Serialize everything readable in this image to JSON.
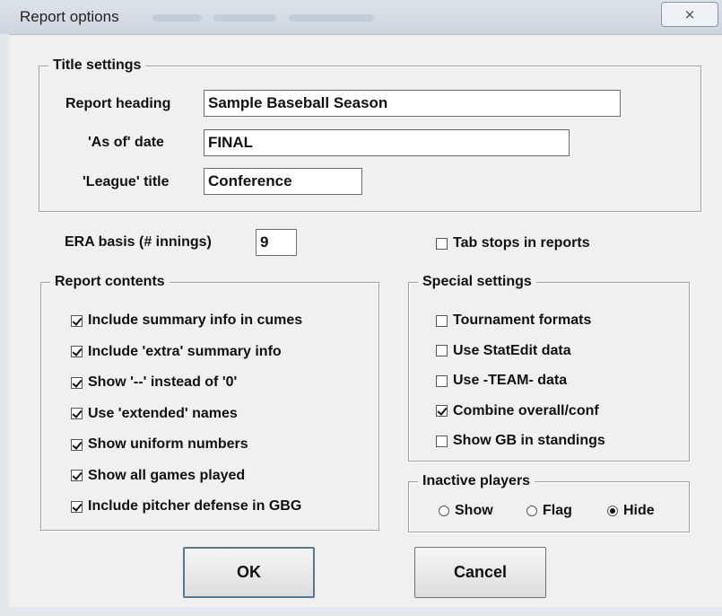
{
  "window": {
    "title": "Report options",
    "close_glyph": "⨯"
  },
  "title_settings": {
    "legend": "Title settings",
    "report_heading": {
      "label": "Report heading",
      "value": "Sample Baseball Season"
    },
    "as_of_date": {
      "label": "'As of' date",
      "value": "FINAL"
    },
    "league_title": {
      "label": "'League' title",
      "value": "Conference"
    }
  },
  "era_basis": {
    "label": "ERA basis (# innings)",
    "value": "9"
  },
  "tab_stops": {
    "label": "Tab stops in reports",
    "checked": false
  },
  "report_contents": {
    "legend": "Report contents",
    "items": [
      {
        "label": "Include summary info in cumes",
        "checked": true
      },
      {
        "label": "Include 'extra' summary info",
        "checked": true
      },
      {
        "label": "Show '--' instead of '0'",
        "checked": true
      },
      {
        "label": "Use 'extended' names",
        "checked": true
      },
      {
        "label": "Show uniform numbers",
        "checked": true
      },
      {
        "label": "Show all games played",
        "checked": true
      },
      {
        "label": "Include pitcher defense in GBG",
        "checked": true
      }
    ]
  },
  "special_settings": {
    "legend": "Special settings",
    "items": [
      {
        "label": "Tournament formats",
        "checked": false
      },
      {
        "label": "Use StatEdit data",
        "checked": false
      },
      {
        "label": "Use -TEAM- data",
        "checked": false
      },
      {
        "label": "Combine overall/conf",
        "checked": true
      },
      {
        "label": "Show GB in standings",
        "checked": false
      }
    ]
  },
  "inactive_players": {
    "legend": "Inactive players",
    "options": [
      {
        "label": "Show",
        "selected": false
      },
      {
        "label": "Flag",
        "selected": false
      },
      {
        "label": "Hide",
        "selected": true
      }
    ]
  },
  "buttons": {
    "ok": "OK",
    "cancel": "Cancel"
  }
}
